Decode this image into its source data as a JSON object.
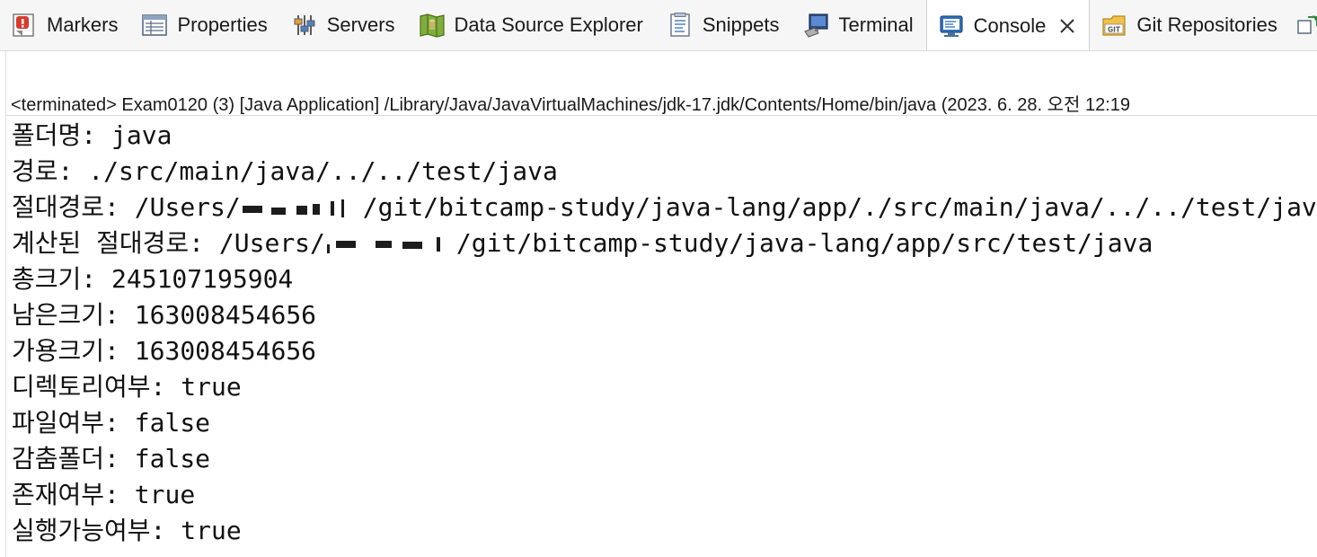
{
  "tabs": [
    {
      "label": "Markers",
      "icon": "markers-icon"
    },
    {
      "label": "Properties",
      "icon": "properties-icon"
    },
    {
      "label": "Servers",
      "icon": "servers-icon"
    },
    {
      "label": "Data Source Explorer",
      "icon": "data-source-explorer-icon"
    },
    {
      "label": "Snippets",
      "icon": "snippets-icon"
    },
    {
      "label": "Terminal",
      "icon": "terminal-icon"
    },
    {
      "label": "Console",
      "icon": "console-icon",
      "active": true
    },
    {
      "label": "Git Repositories",
      "icon": "git-repositories-icon"
    }
  ],
  "console": {
    "status": "<terminated> Exam0120 (3) [Java Application] /Library/Java/JavaVirtualMachines/jdk-17.jdk/Contents/Home/bin/java  (2023. 6. 28. 오전 12:19",
    "lines": {
      "l0": "폴더명: java",
      "l1": "경로: ./src/main/java/../../test/java",
      "l2_pre": "절대경로: /Users/",
      "l2_post": "/git/bitcamp-study/java-lang/app/./src/main/java/../../test/java",
      "l3_pre": "계산된 절대경로: /Users/",
      "l3_post": "/git/bitcamp-study/java-lang/app/src/test/java",
      "l4": "총크기: 245107195904",
      "l5": "남은크기: 163008454656",
      "l6": "가용크기: 163008454656",
      "l7": "디렉토리여부: true",
      "l8": "파일여부: false",
      "l9": "감춤폴더: false",
      "l10": "존재여부: true",
      "l11": "실행가능여부: true"
    }
  },
  "colors": {
    "tabbar_bg": "#f6f6f6",
    "active_tab_bg": "#ffffff",
    "text": "#111111",
    "console_icon_blue": "#2f6fb7"
  }
}
